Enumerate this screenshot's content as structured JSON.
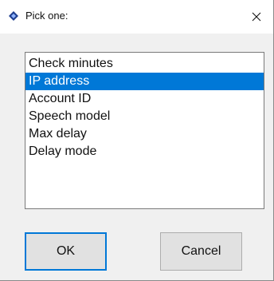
{
  "window": {
    "title": "Pick one:",
    "app_icon": "diamond-icon",
    "close_icon": "close-icon"
  },
  "list": {
    "items": [
      {
        "label": "Check minutes",
        "selected": false
      },
      {
        "label": "IP address",
        "selected": true
      },
      {
        "label": "Account ID",
        "selected": false
      },
      {
        "label": "Speech model",
        "selected": false
      },
      {
        "label": "Max delay",
        "selected": false
      },
      {
        "label": "Delay mode",
        "selected": false
      }
    ],
    "selected_index": 1
  },
  "buttons": {
    "ok_label": "OK",
    "cancel_label": "Cancel"
  },
  "colors": {
    "selection": "#0078d7",
    "window_bg": "#f0f0f0",
    "app_icon": "#1f3f8f"
  }
}
